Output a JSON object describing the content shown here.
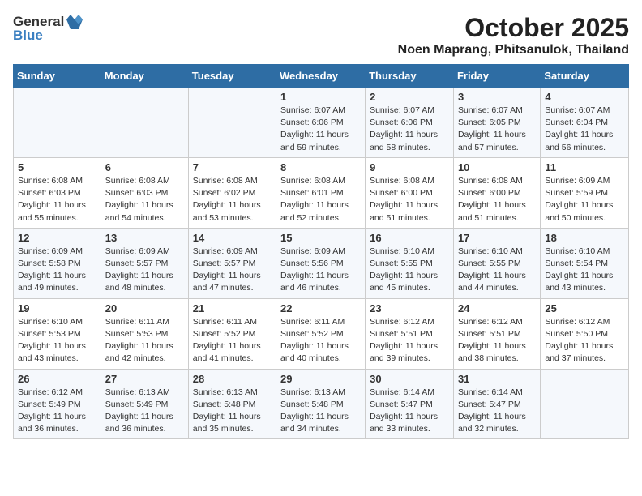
{
  "logo": {
    "general": "General",
    "blue": "Blue"
  },
  "title": "October 2025",
  "location": "Noen Maprang, Phitsanulok, Thailand",
  "days_header": [
    "Sunday",
    "Monday",
    "Tuesday",
    "Wednesday",
    "Thursday",
    "Friday",
    "Saturday"
  ],
  "weeks": [
    [
      {
        "day": "",
        "info": ""
      },
      {
        "day": "",
        "info": ""
      },
      {
        "day": "",
        "info": ""
      },
      {
        "day": "1",
        "info": "Sunrise: 6:07 AM\nSunset: 6:06 PM\nDaylight: 11 hours\nand 59 minutes."
      },
      {
        "day": "2",
        "info": "Sunrise: 6:07 AM\nSunset: 6:06 PM\nDaylight: 11 hours\nand 58 minutes."
      },
      {
        "day": "3",
        "info": "Sunrise: 6:07 AM\nSunset: 6:05 PM\nDaylight: 11 hours\nand 57 minutes."
      },
      {
        "day": "4",
        "info": "Sunrise: 6:07 AM\nSunset: 6:04 PM\nDaylight: 11 hours\nand 56 minutes."
      }
    ],
    [
      {
        "day": "5",
        "info": "Sunrise: 6:08 AM\nSunset: 6:03 PM\nDaylight: 11 hours\nand 55 minutes."
      },
      {
        "day": "6",
        "info": "Sunrise: 6:08 AM\nSunset: 6:03 PM\nDaylight: 11 hours\nand 54 minutes."
      },
      {
        "day": "7",
        "info": "Sunrise: 6:08 AM\nSunset: 6:02 PM\nDaylight: 11 hours\nand 53 minutes."
      },
      {
        "day": "8",
        "info": "Sunrise: 6:08 AM\nSunset: 6:01 PM\nDaylight: 11 hours\nand 52 minutes."
      },
      {
        "day": "9",
        "info": "Sunrise: 6:08 AM\nSunset: 6:00 PM\nDaylight: 11 hours\nand 51 minutes."
      },
      {
        "day": "10",
        "info": "Sunrise: 6:08 AM\nSunset: 6:00 PM\nDaylight: 11 hours\nand 51 minutes."
      },
      {
        "day": "11",
        "info": "Sunrise: 6:09 AM\nSunset: 5:59 PM\nDaylight: 11 hours\nand 50 minutes."
      }
    ],
    [
      {
        "day": "12",
        "info": "Sunrise: 6:09 AM\nSunset: 5:58 PM\nDaylight: 11 hours\nand 49 minutes."
      },
      {
        "day": "13",
        "info": "Sunrise: 6:09 AM\nSunset: 5:57 PM\nDaylight: 11 hours\nand 48 minutes."
      },
      {
        "day": "14",
        "info": "Sunrise: 6:09 AM\nSunset: 5:57 PM\nDaylight: 11 hours\nand 47 minutes."
      },
      {
        "day": "15",
        "info": "Sunrise: 6:09 AM\nSunset: 5:56 PM\nDaylight: 11 hours\nand 46 minutes."
      },
      {
        "day": "16",
        "info": "Sunrise: 6:10 AM\nSunset: 5:55 PM\nDaylight: 11 hours\nand 45 minutes."
      },
      {
        "day": "17",
        "info": "Sunrise: 6:10 AM\nSunset: 5:55 PM\nDaylight: 11 hours\nand 44 minutes."
      },
      {
        "day": "18",
        "info": "Sunrise: 6:10 AM\nSunset: 5:54 PM\nDaylight: 11 hours\nand 43 minutes."
      }
    ],
    [
      {
        "day": "19",
        "info": "Sunrise: 6:10 AM\nSunset: 5:53 PM\nDaylight: 11 hours\nand 43 minutes."
      },
      {
        "day": "20",
        "info": "Sunrise: 6:11 AM\nSunset: 5:53 PM\nDaylight: 11 hours\nand 42 minutes."
      },
      {
        "day": "21",
        "info": "Sunrise: 6:11 AM\nSunset: 5:52 PM\nDaylight: 11 hours\nand 41 minutes."
      },
      {
        "day": "22",
        "info": "Sunrise: 6:11 AM\nSunset: 5:52 PM\nDaylight: 11 hours\nand 40 minutes."
      },
      {
        "day": "23",
        "info": "Sunrise: 6:12 AM\nSunset: 5:51 PM\nDaylight: 11 hours\nand 39 minutes."
      },
      {
        "day": "24",
        "info": "Sunrise: 6:12 AM\nSunset: 5:51 PM\nDaylight: 11 hours\nand 38 minutes."
      },
      {
        "day": "25",
        "info": "Sunrise: 6:12 AM\nSunset: 5:50 PM\nDaylight: 11 hours\nand 37 minutes."
      }
    ],
    [
      {
        "day": "26",
        "info": "Sunrise: 6:12 AM\nSunset: 5:49 PM\nDaylight: 11 hours\nand 36 minutes."
      },
      {
        "day": "27",
        "info": "Sunrise: 6:13 AM\nSunset: 5:49 PM\nDaylight: 11 hours\nand 36 minutes."
      },
      {
        "day": "28",
        "info": "Sunrise: 6:13 AM\nSunset: 5:48 PM\nDaylight: 11 hours\nand 35 minutes."
      },
      {
        "day": "29",
        "info": "Sunrise: 6:13 AM\nSunset: 5:48 PM\nDaylight: 11 hours\nand 34 minutes."
      },
      {
        "day": "30",
        "info": "Sunrise: 6:14 AM\nSunset: 5:47 PM\nDaylight: 11 hours\nand 33 minutes."
      },
      {
        "day": "31",
        "info": "Sunrise: 6:14 AM\nSunset: 5:47 PM\nDaylight: 11 hours\nand 32 minutes."
      },
      {
        "day": "",
        "info": ""
      }
    ]
  ]
}
